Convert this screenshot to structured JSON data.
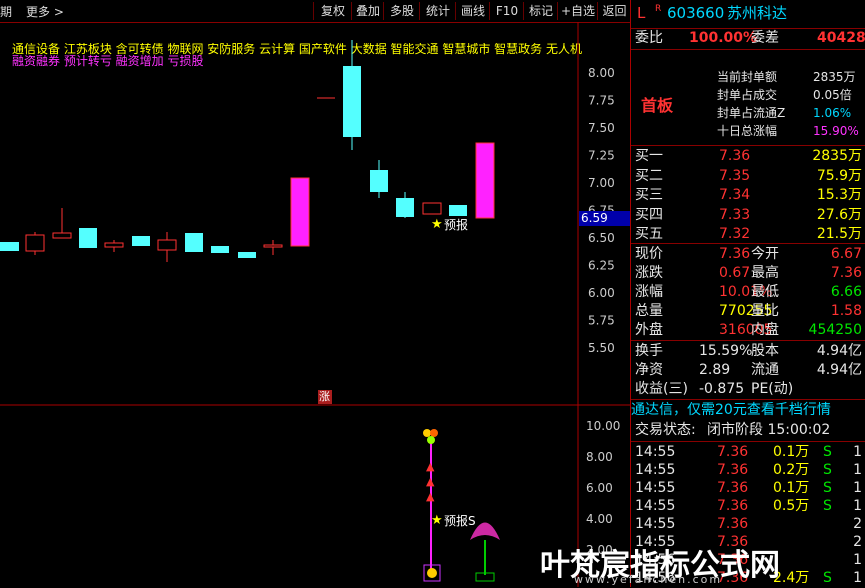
{
  "toolbar": {
    "left_labels": [
      "期",
      "更多 >"
    ],
    "buttons": [
      "复权",
      "叠加",
      "多股",
      "统计",
      "画线",
      "F10",
      "标记",
      "+自选",
      "返回"
    ]
  },
  "concepts": {
    "line1": "通信设备  江苏板块  含可转债 物联网 安防服务 云计算 国产软件 大数据 智能交通 智慧城市 智慧政务 无人机",
    "line2": "融资融券 预计转亏 融资增加 亏损股"
  },
  "main_chart": {
    "y_ticks": [
      "8.00",
      "7.75",
      "7.50",
      "7.25",
      "7.00",
      "6.75",
      "6.50",
      "6.25",
      "6.00",
      "5.75",
      "5.50"
    ],
    "current_price_tag": "6.59",
    "annotation": "预报",
    "limit_marker": "涨"
  },
  "sub_chart": {
    "y_ticks": [
      "10.00",
      "8.00",
      "6.00",
      "4.00",
      "2.00"
    ],
    "annotation": "预报S"
  },
  "header": {
    "market": "L",
    "flag": "R",
    "code": "603660",
    "name": "苏州科达"
  },
  "weibi": {
    "label1": "委比",
    "value1": "100.00%",
    "label2": "委差",
    "value2": "40428"
  },
  "limit_info": {
    "title": "首板",
    "rows": [
      {
        "label": "当前封单额",
        "value": "2835万"
      },
      {
        "label": "封单占成交",
        "value": "0.05倍"
      },
      {
        "label": "封单占流通Z",
        "value": "1.06%"
      },
      {
        "label": "十日总涨幅",
        "value": "15.90%"
      }
    ]
  },
  "bids": [
    {
      "label": "买一",
      "price": "7.36",
      "vol": "2835万"
    },
    {
      "label": "买二",
      "price": "7.35",
      "vol": "75.9万"
    },
    {
      "label": "买三",
      "price": "7.34",
      "vol": "15.3万"
    },
    {
      "label": "买四",
      "price": "7.33",
      "vol": "27.6万"
    },
    {
      "label": "买五",
      "price": "7.32",
      "vol": "21.5万"
    }
  ],
  "stats": [
    {
      "l1": "现价",
      "v1": "7.36",
      "l2": "今开",
      "v2": "6.67"
    },
    {
      "l1": "涨跌",
      "v1": "0.67",
      "l2": "最高",
      "v2": "7.36"
    },
    {
      "l1": "涨幅",
      "v1": "10.01%",
      "l2": "最低",
      "v2": "6.66"
    },
    {
      "l1": "总量",
      "v1": "770255",
      "l2": "量比",
      "v2": "1.58"
    },
    {
      "l1": "外盘",
      "v1": "316005",
      "l2": "内盘",
      "v2": "454250"
    }
  ],
  "fundamentals": [
    {
      "l1": "换手",
      "v1": "15.59%",
      "l2": "股本",
      "v2": "4.94亿"
    },
    {
      "l1": "净资",
      "v1": "2.89",
      "l2": "流通",
      "v2": "4.94亿"
    },
    {
      "l1": "收益(三)",
      "v1": "-0.875",
      "l2": "PE(动)",
      "v2": ""
    }
  ],
  "promo": "通达信，仅需20元查看千档行情",
  "trade_status": {
    "label": "交易状态:",
    "value": "闭市阶段 15:00:02"
  },
  "ticks": [
    {
      "time": "14:55",
      "price": "7.36",
      "vol": "0.1万",
      "side": "S",
      "n": "1"
    },
    {
      "time": "14:55",
      "price": "7.36",
      "vol": "0.2万",
      "side": "S",
      "n": "1"
    },
    {
      "time": "14:55",
      "price": "7.36",
      "vol": "0.1万",
      "side": "S",
      "n": "1"
    },
    {
      "time": "14:55",
      "price": "7.36",
      "vol": "0.5万",
      "side": "S",
      "n": "1"
    },
    {
      "time": "14:55",
      "price": "7.36",
      "vol": "",
      "side": "",
      "n": "2"
    },
    {
      "time": "14:55",
      "price": "7.36",
      "vol": "",
      "side": "",
      "n": "2"
    },
    {
      "time": "14:56",
      "price": "7.36",
      "vol": "",
      "side": "",
      "n": "1"
    },
    {
      "time": "14:56",
      "price": "7.36",
      "vol": "2.4万",
      "side": "S",
      "n": "1"
    }
  ],
  "watermark": "叶梵宸指标公式网",
  "watermark_url": "www.yefanchen.com"
}
